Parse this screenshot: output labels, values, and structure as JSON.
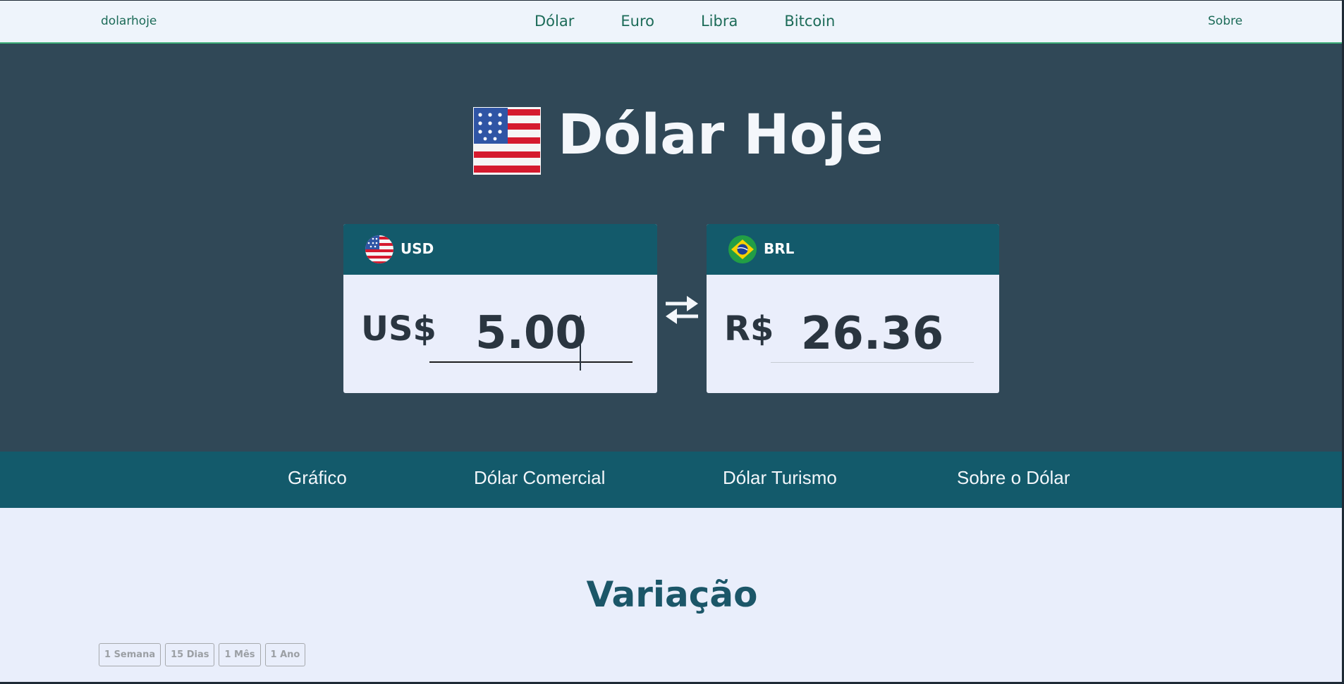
{
  "nav": {
    "brand": "dolarhoje",
    "links": [
      "Dólar",
      "Euro",
      "Libra",
      "Bitcoin"
    ],
    "about": "Sobre"
  },
  "hero": {
    "title": "Dólar Hoje",
    "flag_icon": "us-flag-icon"
  },
  "converter": {
    "from": {
      "code": "USD",
      "symbol": "US$",
      "value": "5.00",
      "flag_icon": "us-flag-round-icon"
    },
    "to": {
      "code": "BRL",
      "symbol": "R$",
      "value": "26.36",
      "flag_icon": "br-flag-round-icon"
    },
    "swap_icon": "swap-arrows-icon"
  },
  "tabs": [
    "Gráfico",
    "Dólar Comercial",
    "Dólar Turismo",
    "Sobre o Dólar"
  ],
  "variation": {
    "title": "Variação",
    "ranges": [
      "1 Semana",
      "15 Dias",
      "1 Mês",
      "1 Ano"
    ]
  },
  "colors": {
    "hero_bg": "#304857",
    "accent": "#135a6b",
    "nav_link": "#1c6b58"
  }
}
